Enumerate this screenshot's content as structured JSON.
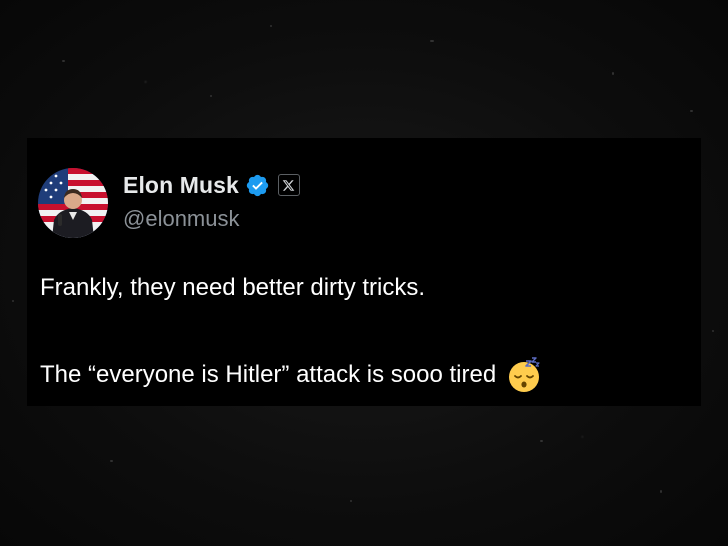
{
  "tweet": {
    "display_name": "Elon Musk",
    "handle": "@elonmusk",
    "line1": "Frankly, they need better dirty tricks.",
    "line2": "The “everyone is Hitler” attack is sooo tired"
  },
  "icons": {
    "verified": "verified-badge-icon",
    "platform": "x-logo-icon",
    "emoji": "sleeping-face-emoji"
  },
  "colors": {
    "card_background": "#000000",
    "name_text": "#e7e9ea",
    "handle_text": "#8b9197",
    "body_text": "#ffffff",
    "verified_blue": "#1d9bf0"
  }
}
